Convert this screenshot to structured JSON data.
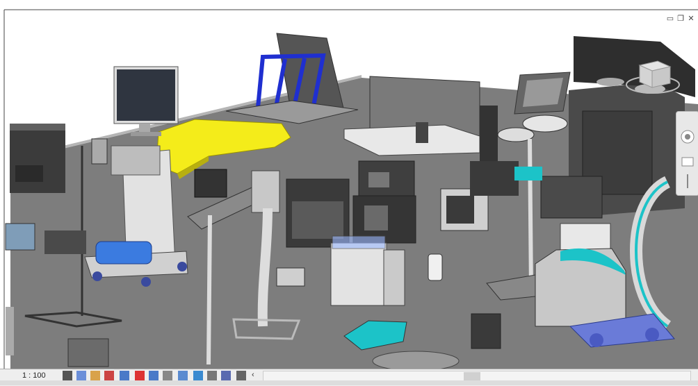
{
  "window": {
    "minimize_icon": "minimize-icon",
    "restore_icon": "restore-icon",
    "close_icon": "close-icon"
  },
  "status": {
    "scale": "1 : 100"
  },
  "colors": {
    "floor": "#7a7a7a",
    "equipment": "#c8c8c8",
    "highlight_yellow": "#f4ec1a",
    "accent_blue": "#1f2fd0",
    "accent_cyan": "#1cc3c8",
    "dark": "#3a3a3a"
  }
}
